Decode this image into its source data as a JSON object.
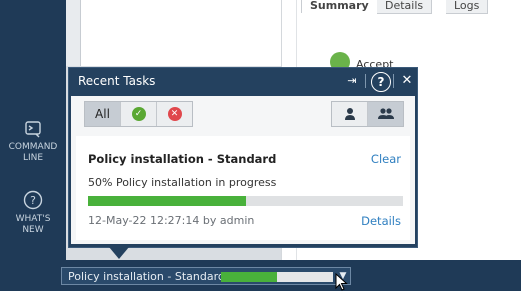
{
  "nav": {
    "command_line": {
      "label": "COMMAND\nLINE",
      "icon": "terminal-icon"
    },
    "whats_new": {
      "label": "WHAT'S\nNEW",
      "icon": "question-circle-icon"
    }
  },
  "tabs": {
    "summary": "Summary",
    "details": "Details",
    "logs": "Logs"
  },
  "summary": {
    "status_label": "Accept",
    "status_icon": "accept-icon"
  },
  "popup": {
    "title": "Recent Tasks",
    "filters": {
      "all": "All",
      "success_icon": "check-circle-icon",
      "failed_icon": "x-circle-icon"
    },
    "user_filters": {
      "mine_icon": "single-user-icon",
      "all_icon": "multi-user-icon"
    },
    "task": {
      "title": "Policy installation - Standard",
      "clear": "Clear",
      "percent": "50%",
      "progress_text": "Policy installation in progress",
      "progress": 0.5,
      "timestamp": "12-May-22 12:27:14",
      "by": "by admin",
      "details": "Details"
    }
  },
  "status_bar": {
    "task_text": "Policy installation - Standard",
    "progress": 0.5
  },
  "colors": {
    "nav_bg": "#1f3a57",
    "popup_bg": "#24415f",
    "progress_green": "#49b13b",
    "link_blue": "#2f7fc0",
    "success_green": "#5aa833",
    "error_red": "#e0474c"
  }
}
